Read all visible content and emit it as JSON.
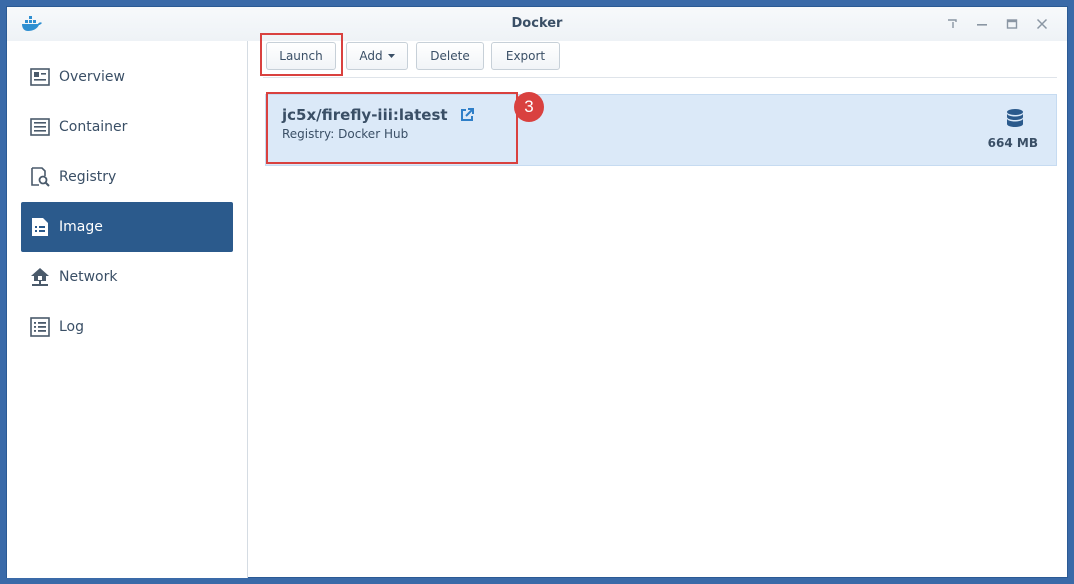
{
  "window": {
    "title": "Docker",
    "app_icon": "docker-whale-icon"
  },
  "window_controls": [
    {
      "name": "help-icon"
    },
    {
      "name": "minimize-icon"
    },
    {
      "name": "maximize-icon"
    },
    {
      "name": "close-icon"
    }
  ],
  "sidebar": {
    "items": [
      {
        "label": "Overview",
        "icon": "overview-icon",
        "active": false
      },
      {
        "label": "Container",
        "icon": "container-icon",
        "active": false
      },
      {
        "label": "Registry",
        "icon": "registry-icon",
        "active": false
      },
      {
        "label": "Image",
        "icon": "image-icon",
        "active": true
      },
      {
        "label": "Network",
        "icon": "network-icon",
        "active": false
      },
      {
        "label": "Log",
        "icon": "log-icon",
        "active": false
      }
    ]
  },
  "toolbar": {
    "launch_label": "Launch",
    "add_label": "Add",
    "delete_label": "Delete",
    "export_label": "Export"
  },
  "images": [
    {
      "name": "jc5x/firefly-iii:latest",
      "registry": "Registry: Docker Hub",
      "size": "664 MB"
    }
  ],
  "annotation": {
    "step": "3"
  },
  "colors": {
    "accent": "#2b5a8c",
    "highlight": "#d9413f",
    "row_selected": "#dbe9f8",
    "text": "#3a4f66"
  }
}
